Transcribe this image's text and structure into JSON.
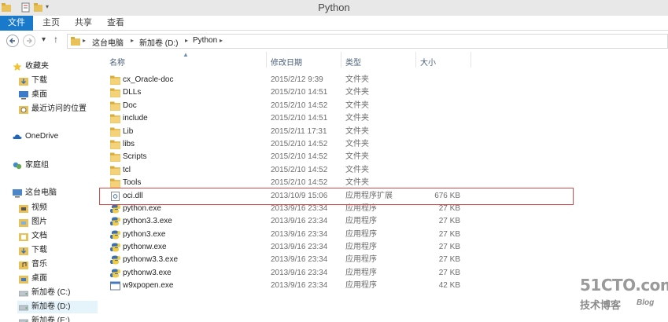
{
  "window": {
    "title": "Python"
  },
  "ribbon": {
    "tabs": [
      "文件",
      "主页",
      "共享",
      "查看"
    ]
  },
  "address": {
    "crumbs": [
      "这台电脑",
      "新加卷 (D:)",
      "Python"
    ]
  },
  "nav": {
    "favorites": {
      "label": "收藏夹",
      "items": [
        "下载",
        "桌面",
        "最近访问的位置"
      ]
    },
    "onedrive": "OneDrive",
    "homegroup": "家庭组",
    "thispc": {
      "label": "这台电脑",
      "items": [
        "视频",
        "图片",
        "文档",
        "下载",
        "音乐",
        "桌面",
        "新加卷 (C:)",
        "新加卷 (D:)",
        "新加卷 (E:)"
      ]
    }
  },
  "columns": {
    "name": "名称",
    "date": "修改日期",
    "type": "类型",
    "size": "大小"
  },
  "files": [
    {
      "name": "cx_Oracle-doc",
      "date": "2015/2/12 9:39",
      "type": "文件夹",
      "size": "",
      "icon": "folder-icon"
    },
    {
      "name": "DLLs",
      "date": "2015/2/10 14:51",
      "type": "文件夹",
      "size": "",
      "icon": "folder-icon"
    },
    {
      "name": "Doc",
      "date": "2015/2/10 14:52",
      "type": "文件夹",
      "size": "",
      "icon": "folder-icon"
    },
    {
      "name": "include",
      "date": "2015/2/10 14:51",
      "type": "文件夹",
      "size": "",
      "icon": "folder-icon"
    },
    {
      "name": "Lib",
      "date": "2015/2/11 17:31",
      "type": "文件夹",
      "size": "",
      "icon": "folder-icon"
    },
    {
      "name": "libs",
      "date": "2015/2/10 14:52",
      "type": "文件夹",
      "size": "",
      "icon": "folder-icon"
    },
    {
      "name": "Scripts",
      "date": "2015/2/10 14:52",
      "type": "文件夹",
      "size": "",
      "icon": "folder-icon"
    },
    {
      "name": "tcl",
      "date": "2015/2/10 14:52",
      "type": "文件夹",
      "size": "",
      "icon": "folder-icon"
    },
    {
      "name": "Tools",
      "date": "2015/2/10 14:52",
      "type": "文件夹",
      "size": "",
      "icon": "folder-icon"
    },
    {
      "name": "oci.dll",
      "date": "2013/10/9 15:06",
      "type": "应用程序扩展",
      "size": "676 KB",
      "icon": "dll-icon"
    },
    {
      "name": "python.exe",
      "date": "2013/9/16 23:34",
      "type": "应用程序",
      "size": "27 KB",
      "icon": "python-icon"
    },
    {
      "name": "python3.3.exe",
      "date": "2013/9/16 23:34",
      "type": "应用程序",
      "size": "27 KB",
      "icon": "python-icon"
    },
    {
      "name": "python3.exe",
      "date": "2013/9/16 23:34",
      "type": "应用程序",
      "size": "27 KB",
      "icon": "python-icon"
    },
    {
      "name": "pythonw.exe",
      "date": "2013/9/16 23:34",
      "type": "应用程序",
      "size": "27 KB",
      "icon": "python-icon"
    },
    {
      "name": "pythonw3.3.exe",
      "date": "2013/9/16 23:34",
      "type": "应用程序",
      "size": "27 KB",
      "icon": "python-icon"
    },
    {
      "name": "pythonw3.exe",
      "date": "2013/9/16 23:34",
      "type": "应用程序",
      "size": "27 KB",
      "icon": "python-icon"
    },
    {
      "name": "w9xpopen.exe",
      "date": "2013/9/16 23:34",
      "type": "应用程序",
      "size": "42 KB",
      "icon": "exe-icon"
    }
  ],
  "watermark": {
    "main": "51CTO.com",
    "sub": "技术博客",
    "blog": "Blog"
  },
  "colors": {
    "file_tab": "#1979ca",
    "highlight": "#d24a4a",
    "folder": "#e8c15a"
  }
}
